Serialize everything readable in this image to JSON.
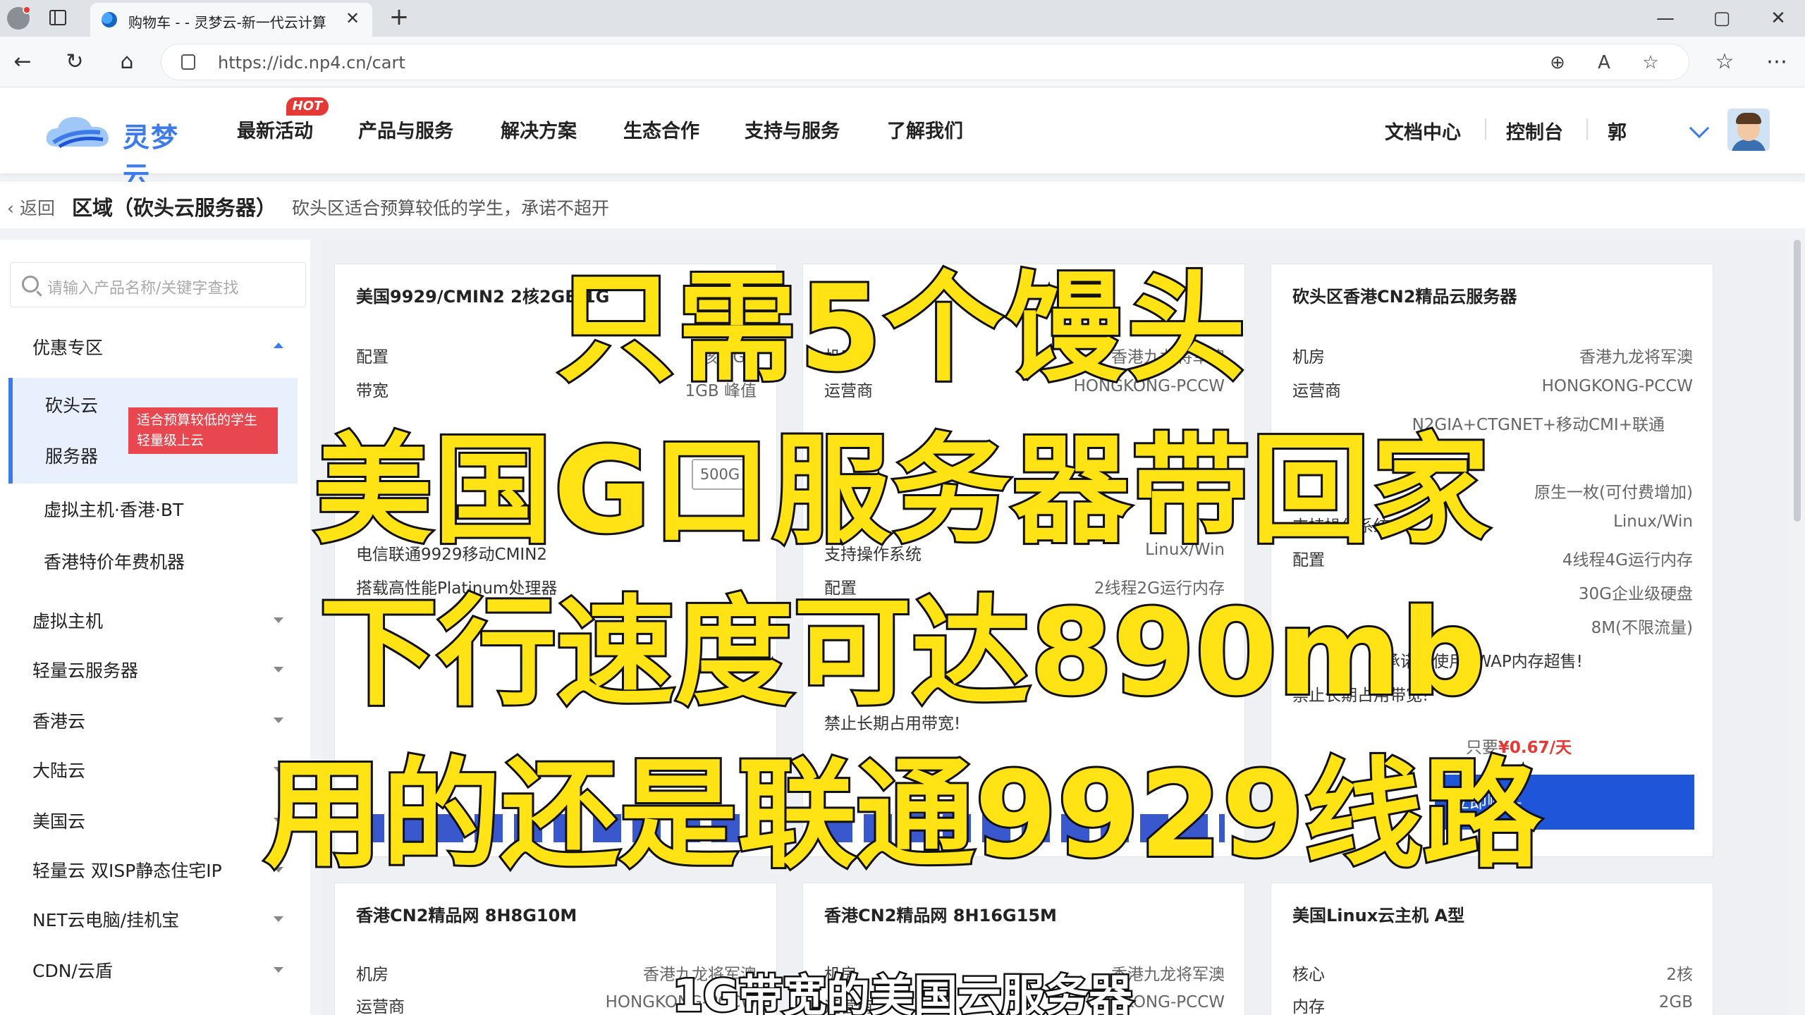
{
  "browser": {
    "tab_title": "购物车 - - 灵梦云-新一代云计算服",
    "tab_close": "✕",
    "new_tab": "+",
    "url": "https://idc.np4.cn/cart",
    "window": {
      "minimize": "—",
      "maximize": "▢",
      "close": "✕"
    },
    "nav": {
      "back": "←",
      "reload": "↻",
      "home": "⌂"
    },
    "toolbar_icons": {
      "zoom": "⊕",
      "read_aloud": "A",
      "favorite": "☆",
      "favorites": "☆",
      "more": "⋯"
    }
  },
  "site": {
    "logo_text": "灵梦云",
    "brand_color": "#3d7bea",
    "nav": [
      "最新活动",
      "产品与服务",
      "解决方案",
      "生态合作",
      "支持与服务",
      "了解我们"
    ],
    "hot_badge": "HOT",
    "right_nav": [
      "文档中心",
      "控制台",
      "郭"
    ]
  },
  "breadcrumb": {
    "back": "返回",
    "region": "区域（砍头云服务器）",
    "description": "砍头区适合预算较低的学生，承诺不超开"
  },
  "sidebar": {
    "search_placeholder": "请输入产品名称/关键字查找",
    "group_discount": "优惠专区",
    "active_item_line1": "砍头云",
    "active_item_line2": "服务器",
    "active_item_tag": "适合预算较低的学生轻量级上云",
    "sub_items": [
      "虚拟主机·香港·BT",
      "香港特价年费机器"
    ],
    "groups": [
      "虚拟主机",
      "轻量云服务器",
      "香港云",
      "大陆云",
      "美国云",
      "轻量云 双ISP静态住宅IP",
      "NET云电脑/挂机宝",
      "CDN/云盾"
    ]
  },
  "cards": [
    {
      "title": "美国9929/CMIN2 2核2GB 1G",
      "rows": [
        {
          "k": "配置",
          "v": "2核 2GB"
        },
        {
          "k": "带宽",
          "v": "1GB 峰值"
        }
      ],
      "badge": "500G",
      "notes": [
        "电信联通9929移动CMIN2",
        "搭载高性能Platinum处理器"
      ]
    },
    {
      "title": "",
      "rows": [
        {
          "k": "机房",
          "v": "香港九龙将军澳"
        },
        {
          "k": "运营商",
          "v": "HONGKONG-PCCW"
        },
        {
          "k": "支持操作系统",
          "v": "Linux/Win"
        },
        {
          "k": "配置",
          "v": "2线程2G运行内存"
        }
      ],
      "notes": [
        "禁止长期占用带宽!"
      ]
    },
    {
      "title": "砍头区香港CN2精品云服务器",
      "rows": [
        {
          "k": "机房",
          "v": "香港九龙将军澳"
        },
        {
          "k": "运营商",
          "v": "HONGKONG-PCCW"
        },
        {
          "k": "",
          "v": "N2GIA+CTGNET+移动CMI+联通"
        },
        {
          "k": "",
          "v": "原生一枚(可付费增加)"
        },
        {
          "k": "支持操作系统",
          "v": "Linux/Win"
        },
        {
          "k": "配置",
          "v": "4线程4G运行内存"
        },
        {
          "k": "",
          "v": "30G企业级硬盘"
        },
        {
          "k": "",
          "v": "8M(不限流量)"
        }
      ],
      "notes": [
        "承诺不使用SWAP内存超售!",
        "禁止长期占用带宽!"
      ],
      "price_prefix": "只要",
      "price": "¥0.67/天",
      "buy": "立即购买"
    },
    {
      "title": "香港CN2精品网 8H8G10M",
      "rows": [
        {
          "k": "机房",
          "v": "香港九龙将军澳"
        },
        {
          "k": "运营商",
          "v": "HONGKONG-PCCW"
        }
      ]
    },
    {
      "title": "香港CN2精品网 8H16G15M",
      "rows": [
        {
          "k": "机房",
          "v": "香港九龙将军澳"
        },
        {
          "k": "运营商",
          "v": "HONGKONG-PCCW"
        }
      ]
    },
    {
      "title": "美国Linux云主机 A型",
      "rows": [
        {
          "k": "核心",
          "v": "2核"
        },
        {
          "k": "内存",
          "v": "2GB"
        }
      ]
    }
  ],
  "overlay": {
    "line1": "只需5个馒头",
    "line2": "美国G口服务器带回家",
    "line3": "下行速度可达890mb",
    "line4": "用的还是联通9929线路",
    "subtitle": "1G带宽的美国云服务器",
    "caption_color": "#ffe314"
  }
}
